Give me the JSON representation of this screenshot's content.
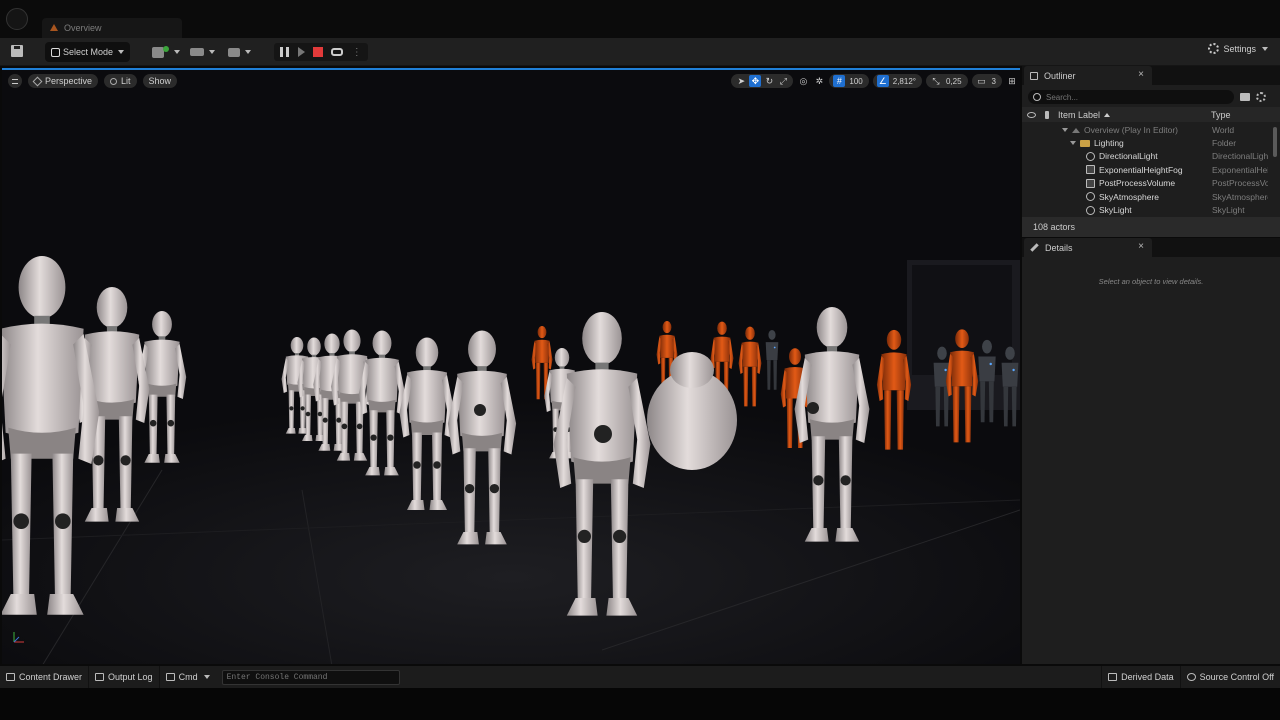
{
  "window": {
    "tab_title": "Overview"
  },
  "toolbar": {
    "mode_label": "Select Mode",
    "settings_label": "Settings"
  },
  "viewport": {
    "view_mode": "Perspective",
    "lighting": "Lit",
    "show_label": "Show",
    "grid_snap": "100",
    "rotation_snap": "2,812°",
    "scale_snap": "0,25",
    "camera_speed": "3",
    "accent_color": "#1f6fd0"
  },
  "outliner": {
    "tab_label": "Outliner",
    "close": "×",
    "search_placeholder": "Search...",
    "col_label": "Item Label",
    "col_type": "Type",
    "rows": [
      {
        "label": "Overview (Play In Editor)",
        "type": "World"
      },
      {
        "label": "Lighting",
        "type": "Folder"
      },
      {
        "label": "DirectionalLight",
        "type": "DirectionalLight"
      },
      {
        "label": "ExponentialHeightFog",
        "type": "ExponentialHeightFog"
      },
      {
        "label": "PostProcessVolume",
        "type": "PostProcessVolume"
      },
      {
        "label": "SkyAtmosphere",
        "type": "SkyAtmosphere"
      },
      {
        "label": "SkyLight",
        "type": "SkyLight"
      }
    ],
    "actor_count": "108 actors"
  },
  "details": {
    "tab_label": "Details",
    "close": "×",
    "empty_message": "Select an object to view details."
  },
  "statusbar": {
    "content_drawer": "Content Drawer",
    "output_log": "Output Log",
    "cmd": "Cmd",
    "console_placeholder": "Enter Console Command",
    "derived_data": "Derived Data",
    "source_control": "Source Control Off"
  }
}
